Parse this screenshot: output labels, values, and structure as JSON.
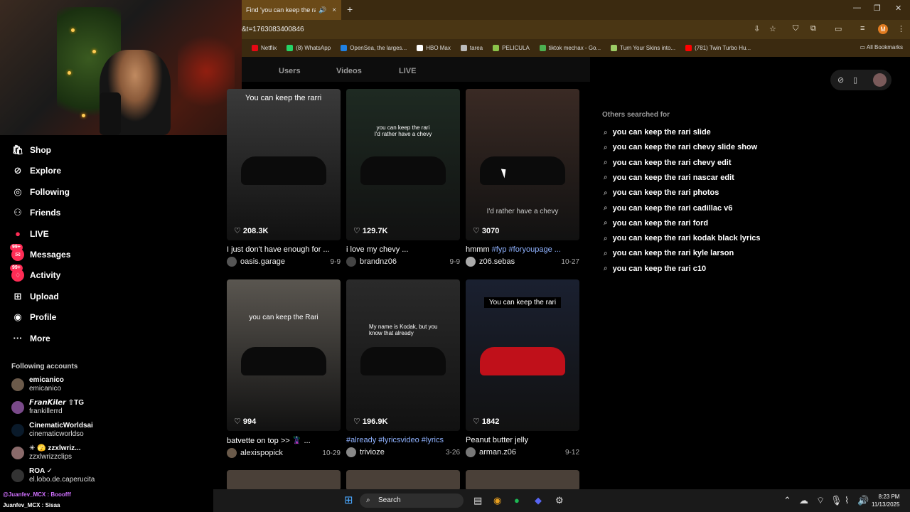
{
  "browser": {
    "tab_title": "Find 'you can keep the rarri'",
    "tab_close": "×",
    "new_tab": "+",
    "url": "&t=1763083400846",
    "avatar_letter": "M",
    "bookmarks": [
      {
        "label": "Netflix",
        "color": "#e50914"
      },
      {
        "label": "(8) WhatsApp",
        "color": "#25d366"
      },
      {
        "label": "OpenSea, the larges...",
        "color": "#2081e2"
      },
      {
        "label": "HBO Max",
        "color": "#ffffff"
      },
      {
        "label": "tarea",
        "color": "#bbbbbb"
      },
      {
        "label": "PELICULA",
        "color": "#8bc34a"
      },
      {
        "label": "tiktok mechax - Go...",
        "color": "#4caf50"
      },
      {
        "label": "Turn Your Skins into...",
        "color": "#9ccc65"
      },
      {
        "label": "(781) Twin Turbo Hu...",
        "color": "#ff0000"
      }
    ],
    "all_bookmarks": "All Bookmarks"
  },
  "sidebar": {
    "nav": [
      {
        "label": "Shop",
        "icon": "shop-icon",
        "badge": ""
      },
      {
        "label": "Explore",
        "icon": "compass-icon",
        "badge": ""
      },
      {
        "label": "Following",
        "icon": "following-icon",
        "badge": ""
      },
      {
        "label": "Friends",
        "icon": "friends-icon",
        "badge": ""
      },
      {
        "label": "LIVE",
        "icon": "live-icon",
        "badge": ""
      },
      {
        "label": "Messages",
        "icon": "messages-icon",
        "badge": "99+"
      },
      {
        "label": "Activity",
        "icon": "activity-icon",
        "badge": "99+"
      },
      {
        "label": "Upload",
        "icon": "upload-icon",
        "badge": ""
      },
      {
        "label": "Profile",
        "icon": "profile-icon",
        "badge": ""
      },
      {
        "label": "More",
        "icon": "more-icon",
        "badge": ""
      }
    ],
    "following_title": "Following accounts",
    "following": [
      {
        "name": "emicanico",
        "user": "emicanico",
        "color": "#6b5a4a"
      },
      {
        "name": "𝙁𝙧𝙖𝙣𝙆𝙞𝙡𝙚𝙧 ⇧TG",
        "user": "frankillerrd",
        "color": "#7a4a8a"
      },
      {
        "name": "CinematicWorldsai",
        "user": "cinematicworldso",
        "color": "#0a1a2a"
      },
      {
        "name": "✳︎ 🫣 zzxlwriz...",
        "user": "zzxlwrizzclips",
        "color": "#8a6a6a"
      },
      {
        "name": "ROA ✓",
        "user": "el.lobo.de.caperucita",
        "color": "#333333"
      }
    ]
  },
  "chat": [
    {
      "text": "@Juanfev_MCX : Booofff",
      "color": "#d070ff"
    },
    {
      "text": "Juanfev_MCX : Sisaa",
      "color": "#ffffff"
    }
  ],
  "search_tabs": [
    "Users",
    "Videos",
    "LIVE"
  ],
  "videos": [
    {
      "likes": "208.3K",
      "caption": "I just don't have enough for ...",
      "user": "oasis.garage",
      "date": "9-9",
      "overlay": "You can keep the rarri",
      "bg": "#3a3a3a",
      "uc": "#555555"
    },
    {
      "likes": "129.7K",
      "caption": "i love my chevy ...",
      "user": "brandnz06",
      "date": "9-9",
      "overlay": "you can keep the rari\nI'd rather have a chevy",
      "bg": "#1e2a22",
      "uc": "#444444"
    },
    {
      "likes": "3070",
      "caption_plain": "hmmm ",
      "caption_tags": "#fyp #foryoupage ...",
      "user": "z06.sebas",
      "date": "10-27",
      "overlay": "I'd rather have a chevy",
      "bg": "#3a2a24",
      "uc": "#aaaaaa"
    },
    {
      "likes": "994",
      "caption": "batvette on top >> 🦹 ...",
      "user": "alexispopick",
      "date": "10-29",
      "overlay": "you can keep the Rari",
      "bg": "#5a5650",
      "uc": "#6a5a4a"
    },
    {
      "likes": "196.9K",
      "caption_tags": "#already #lyricsvideo #lyrics",
      "user": "trivioze",
      "date": "3-26",
      "overlay": "My name is Kodak, but you know that already",
      "bg": "#2a2a2a",
      "uc": "#888888"
    },
    {
      "likes": "1842",
      "caption": "Peanut butter jelly",
      "user": "arman.z06",
      "date": "9-12",
      "overlay": "You can keep the rari",
      "bg": "#1a2030",
      "uc": "#777777"
    }
  ],
  "right": {
    "others_title": "Others searched for",
    "suggestions": [
      "you can keep the rari slide",
      "you can keep the rari chevy slide show",
      "you can keep the rari chevy edit",
      "you can keep the rari nascar edit",
      "you can keep the rari photos",
      "you can keep the rari cadillac v6",
      "you can keep the rari ford",
      "you can keep the rari kodak black lyrics",
      "you can keep the rari kyle larson",
      "you can keep the rari c10"
    ]
  },
  "taskbar": {
    "search": "Search",
    "time": "8:23 PM",
    "date": "11/13/2025"
  }
}
